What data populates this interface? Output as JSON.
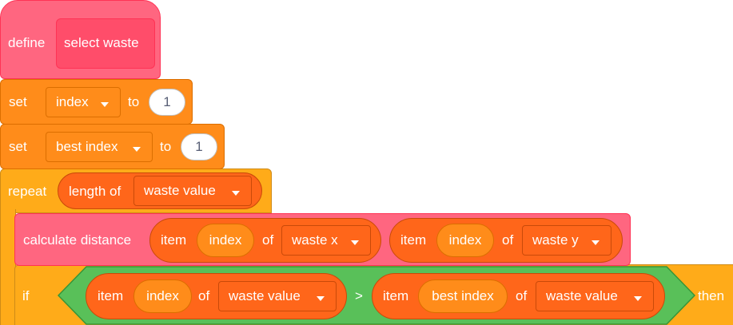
{
  "define_block": {
    "keyword": "define",
    "name": "select waste"
  },
  "set_index": {
    "keyword": "set",
    "variable": "index",
    "to": "to",
    "value": "1"
  },
  "set_best_index": {
    "keyword": "set",
    "variable": "best index",
    "to": "to",
    "value": "1"
  },
  "repeat_block": {
    "keyword": "repeat",
    "length_of": "length of",
    "list": "waste value"
  },
  "calculate_block": {
    "label": "calculate distance",
    "arg1": {
      "item": "item",
      "index": "index",
      "of": "of",
      "list": "waste x"
    },
    "arg2": {
      "item": "item",
      "index": "index",
      "of": "of",
      "list": "waste y"
    }
  },
  "if_block": {
    "keyword": "if",
    "then": "then",
    "operator": ">",
    "left": {
      "item": "item",
      "index": "index",
      "of": "of",
      "list": "waste value"
    },
    "right": {
      "item": "item",
      "index": "best index",
      "of": "of",
      "list": "waste value"
    }
  },
  "colors": {
    "my_blocks": "#ff6680",
    "variables": "#ff8c1a",
    "control": "#ffab19",
    "list_reporter": "#ff661a",
    "operators": "#59c059"
  },
  "icons": {
    "dropdown": "caret-down-icon"
  }
}
